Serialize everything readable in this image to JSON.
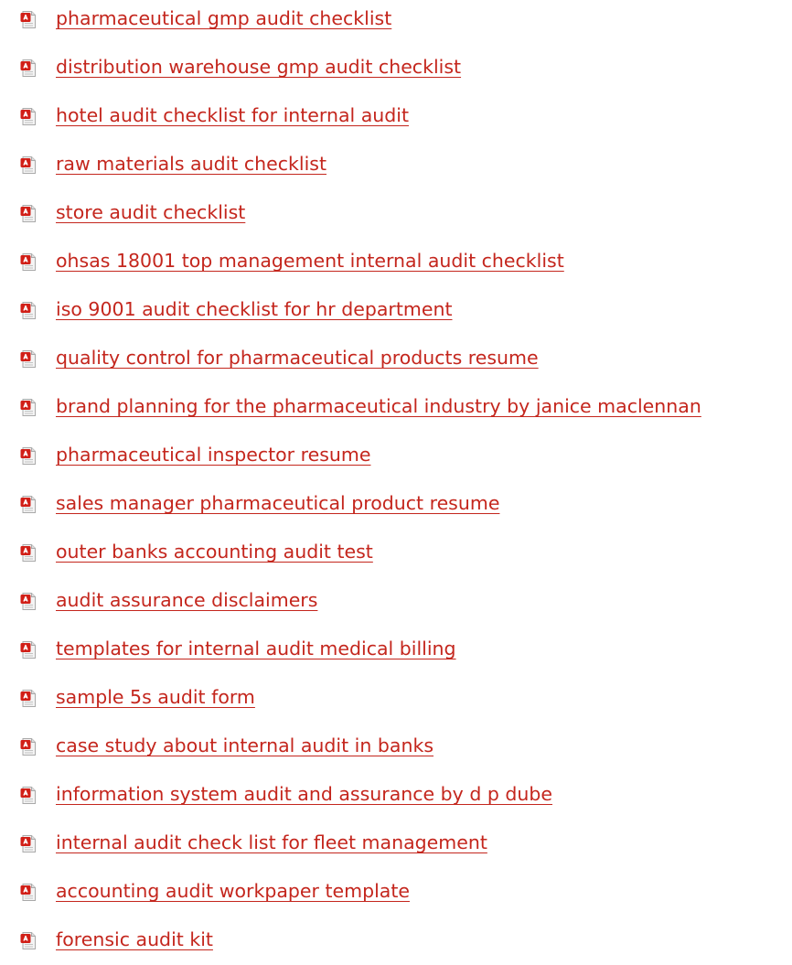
{
  "links": [
    {
      "label": "pharmaceutical gmp audit checklist",
      "icon": "pdf-icon"
    },
    {
      "label": "distribution warehouse gmp audit checklist",
      "icon": "pdf-icon"
    },
    {
      "label": "hotel audit checklist for internal audit",
      "icon": "pdf-icon"
    },
    {
      "label": "raw materials audit checklist",
      "icon": "pdf-icon"
    },
    {
      "label": "store audit checklist",
      "icon": "pdf-icon"
    },
    {
      "label": "ohsas 18001 top management internal audit checklist",
      "icon": "pdf-icon"
    },
    {
      "label": "iso 9001 audit checklist for hr department",
      "icon": "pdf-icon"
    },
    {
      "label": "quality control for pharmaceutical products resume",
      "icon": "pdf-icon"
    },
    {
      "label": "brand planning for the pharmaceutical industry by janice maclennan",
      "icon": "pdf-icon"
    },
    {
      "label": "pharmaceutical inspector resume",
      "icon": "pdf-icon"
    },
    {
      "label": "sales manager pharmaceutical product resume",
      "icon": "pdf-icon"
    },
    {
      "label": "outer banks accounting audit test",
      "icon": "pdf-icon"
    },
    {
      "label": "audit assurance disclaimers",
      "icon": "pdf-icon"
    },
    {
      "label": "templates for internal audit medical billing",
      "icon": "pdf-icon"
    },
    {
      "label": "sample 5s audit form",
      "icon": "pdf-icon"
    },
    {
      "label": "case study about internal audit in banks",
      "icon": "pdf-icon"
    },
    {
      "label": "information system audit and assurance by d p dube",
      "icon": "pdf-icon"
    },
    {
      "label": "internal audit check list for fleet management",
      "icon": "pdf-icon"
    },
    {
      "label": "accounting audit workpaper template",
      "icon": "pdf-icon"
    },
    {
      "label": "forensic audit kit",
      "icon": "pdf-icon"
    }
  ],
  "colors": {
    "link": "#c4261d",
    "pdf_red": "#d11f17",
    "background": "#ffffff"
  }
}
